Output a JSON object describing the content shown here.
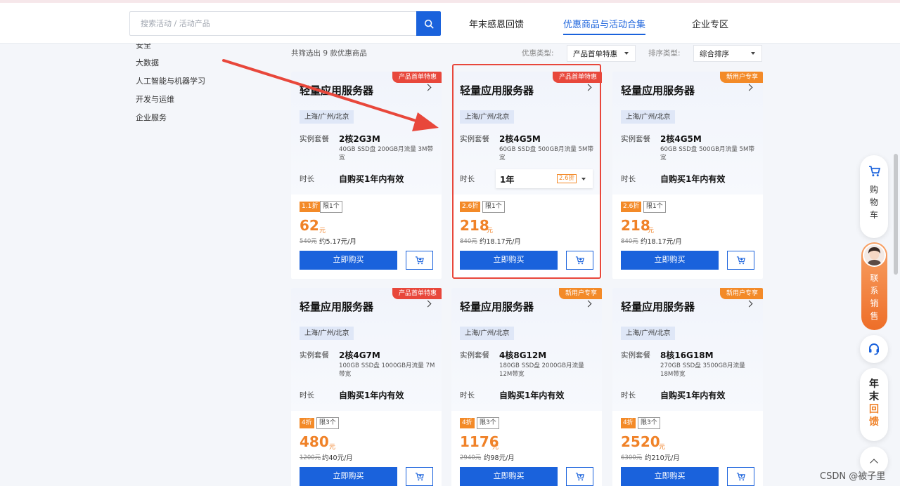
{
  "header": {
    "search_placeholder": "搜索活动 / 活动产品",
    "tabs": [
      {
        "label": "年末感恩回馈"
      },
      {
        "label": "优惠商品与活动合集"
      },
      {
        "label": "企业专区"
      }
    ]
  },
  "sidebar": {
    "items": [
      {
        "label": "安全"
      },
      {
        "label": "大数据"
      },
      {
        "label": "人工智能与机器学习"
      },
      {
        "label": "开发与运维"
      },
      {
        "label": "企业服务"
      }
    ]
  },
  "filters": {
    "count_text": "共筛选出 9 款优惠商品",
    "discount_type_label": "优惠类型:",
    "discount_type_value": "产品首单特惠",
    "sort_label": "排序类型:",
    "sort_value": "综合排序"
  },
  "cards": [
    {
      "badge": "产品首单特惠",
      "title": "轻量应用服务器",
      "region": "上海/广州/北京",
      "spec_label": "实例套餐",
      "spec": "2核2G3M",
      "spec_desc": "40GB SSD盘 200GB月流量 3M带宽",
      "duration_label": "时长",
      "duration": "自购买1年内有效",
      "discount": "1.1折",
      "limit": "限1个",
      "price": "62",
      "unit": "元",
      "original": "540元",
      "monthly": "约5.17元/月",
      "buy": "立即购买"
    },
    {
      "badge": "产品首单特惠",
      "title": "轻量应用服务器",
      "region": "上海/广州/北京",
      "spec_label": "实例套餐",
      "spec": "2核4G5M",
      "spec_desc": "60GB SSD盘 500GB月流量 5M带宽",
      "duration_label": "时长",
      "duration": "1年",
      "duration_tag": "2.6折",
      "discount": "2.6折",
      "limit": "限1个",
      "price": "218",
      "unit": "元",
      "original": "840元",
      "monthly": "约18.17元/月",
      "buy": "立即购买"
    },
    {
      "badge": "新用户专享",
      "title": "轻量应用服务器",
      "region": "上海/广州/北京",
      "spec_label": "实例套餐",
      "spec": "2核4G5M",
      "spec_desc": "60GB SSD盘 500GB月流量 5M带宽",
      "duration_label": "时长",
      "duration": "自购买1年内有效",
      "discount": "2.6折",
      "limit": "限1个",
      "price": "218",
      "unit": "元",
      "original": "840元",
      "monthly": "约18.17元/月",
      "buy": "立即购买"
    },
    {
      "badge": "产品首单特惠",
      "title": "轻量应用服务器",
      "region": "上海/广州/北京",
      "spec_label": "实例套餐",
      "spec": "2核4G7M",
      "spec_desc": "100GB SSD盘 1000GB月流量 7M带宽",
      "duration_label": "时长",
      "duration": "自购买1年内有效",
      "discount": "4折",
      "limit": "限3个",
      "price": "480",
      "unit": "元",
      "original": "1200元",
      "monthly": "约40元/月",
      "buy": "立即购买"
    },
    {
      "badge": "新用户专享",
      "title": "轻量应用服务器",
      "region": "上海/广州/北京",
      "spec_label": "实例套餐",
      "spec": "4核8G12M",
      "spec_desc": "180GB SSD盘 2000GB月流量 12M带宽",
      "duration_label": "时长",
      "duration": "自购买1年内有效",
      "discount": "4折",
      "limit": "限3个",
      "price": "1176",
      "unit": "元",
      "original": "2940元",
      "monthly": "约98元/月",
      "buy": "立即购买"
    },
    {
      "badge": "新用户专享",
      "title": "轻量应用服务器",
      "region": "上海/广州/北京",
      "spec_label": "实例套餐",
      "spec": "8核16G18M",
      "spec_desc": "270GB SSD盘 3500GB月流量 18M带宽",
      "duration_label": "时长",
      "duration": "自购买1年内有效",
      "discount": "4折",
      "limit": "限3个",
      "price": "2520",
      "unit": "元",
      "original": "6300元",
      "monthly": "约210元/月",
      "buy": "立即购买"
    }
  ],
  "floating": {
    "cart_label": "购物车",
    "sales_label": "联系销售",
    "year_label_a": "年末",
    "year_label_b": "回馈"
  },
  "watermark": "CSDN @被子里",
  "colors": {
    "primary": "#1a62dc",
    "badge_red": "#e8473b",
    "badge_orange": "#f38a28",
    "price_orange": "#f08228",
    "annotation_red": "#e8473b"
  }
}
